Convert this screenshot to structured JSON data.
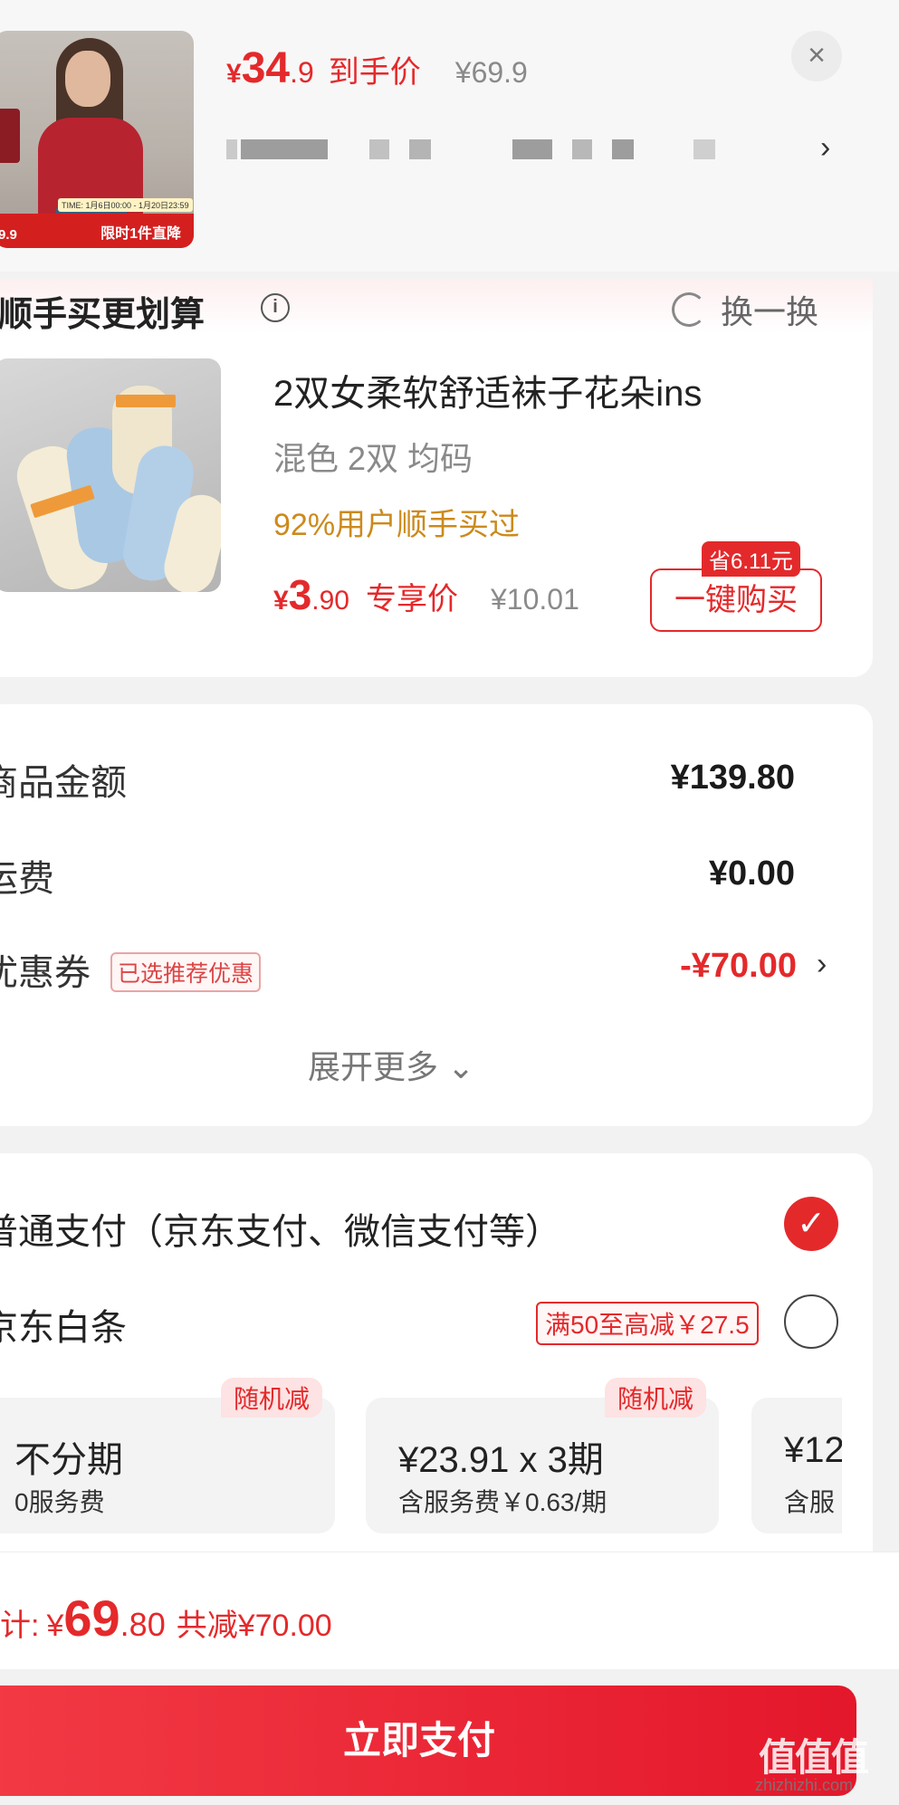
{
  "top": {
    "image_label_1": "限时1件直降",
    "image_label_2": "9.9",
    "image_time": "TIME: 1月6日00:00 - 1月20日23:59",
    "price_symbol": "¥",
    "price_int": "34",
    "price_dec": ".9",
    "price_tag": "到手价",
    "original_price": "¥69.9",
    "close": "×",
    "chevron": "›"
  },
  "recommend": {
    "title": "顺手买更划算",
    "info": "i",
    "swap_label": "换一换",
    "product_name": "2双女柔软舒适袜子花朵ins",
    "spec": "混色 2双   均码",
    "bought_hint": "92%用户顺手买过",
    "price_symbol": "¥",
    "price_int": "3",
    "price_dec": ".90",
    "price_tag": "专享价",
    "original_price": "¥10.01",
    "save_badge": "省6.11元",
    "buy_button": "一键购买"
  },
  "amounts": {
    "goods_label": "商品金额",
    "goods_value": "¥139.80",
    "shipping_label": "运费",
    "shipping_value": "¥0.00",
    "coupon_label": "优惠券",
    "coupon_badge": "已选推荐优惠",
    "coupon_value": "-¥70.00",
    "chevron": "›",
    "expand": "展开更多 ⌄"
  },
  "payment": {
    "normal_label": "普通支付（京东支付、微信支付等）",
    "normal_check": "✓",
    "baitiao_label": "京东白条",
    "baitiao_promo": "满50至高减￥27.5",
    "plans": [
      {
        "badge": "随机减",
        "title": "不分期",
        "sub": "0服务费"
      },
      {
        "badge": "随机减",
        "title": "¥23.91 x 3期",
        "sub": "含服务费￥0.63/期"
      },
      {
        "badge": "",
        "title": "¥12",
        "sub": "含服"
      }
    ]
  },
  "total": {
    "label": "计:",
    "symbol": "¥",
    "int": "69",
    "dec": ".80",
    "discount": "共减¥70.00"
  },
  "pay_button": "立即支付",
  "watermark": "值值值",
  "watermark_url": "zhizhizhi.com"
}
